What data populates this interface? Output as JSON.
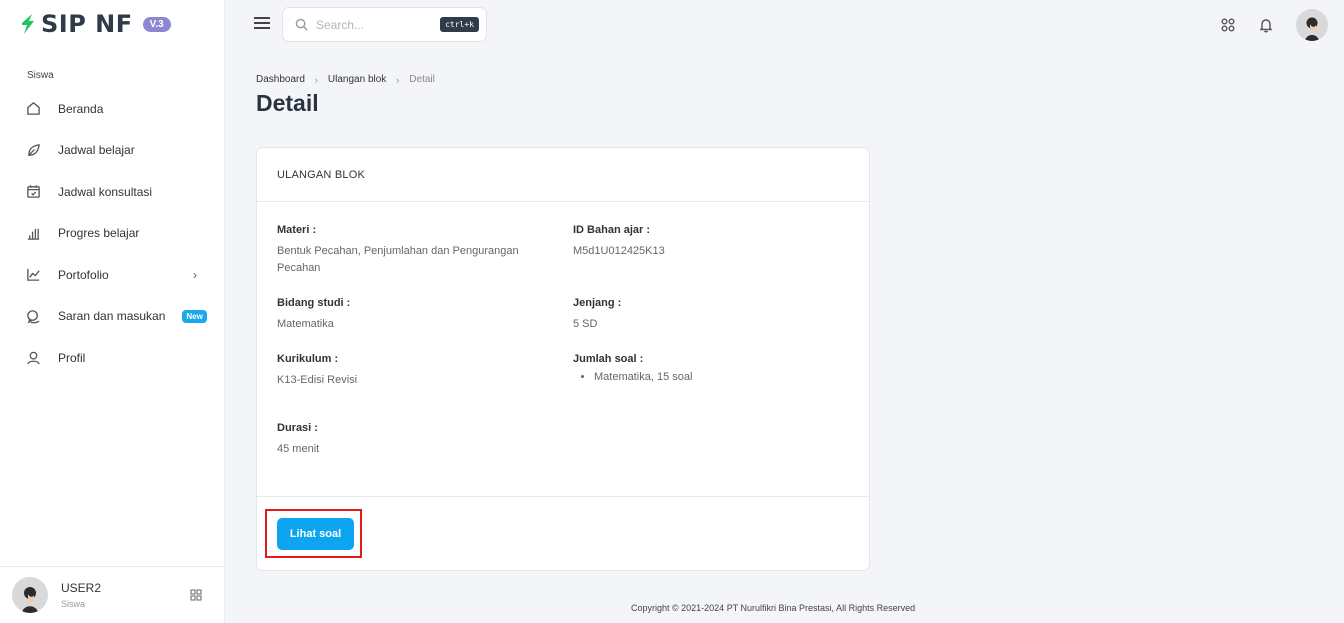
{
  "app": {
    "logo_text": "SIP NF",
    "version_badge": "V.3",
    "brand_green": "#22c55e",
    "accent": "#0ea5f0"
  },
  "sidebar": {
    "section_label": "Siswa",
    "items": [
      {
        "label": "Beranda",
        "icon": "home-icon"
      },
      {
        "label": "Jadwal belajar",
        "icon": "leaf-icon"
      },
      {
        "label": "Jadwal konsultasi",
        "icon": "calendar-check-icon"
      },
      {
        "label": "Progres belajar",
        "icon": "bar-chart-icon"
      },
      {
        "label": "Portofolio",
        "icon": "line-chart-icon",
        "has_submenu": true
      },
      {
        "label": "Saran dan masukan",
        "icon": "chat-icon",
        "badge": "New"
      },
      {
        "label": "Profil",
        "icon": "user-icon"
      }
    ],
    "user": {
      "name": "USER2",
      "role": "Siswa"
    }
  },
  "topbar": {
    "search_placeholder": "Search...",
    "search_shortcut": "ctrl+k"
  },
  "breadcrumb": [
    "Dashboard",
    "Ulangan blok",
    "Detail"
  ],
  "page_title": "Detail",
  "card": {
    "header": "ULANGAN BLOK",
    "fields": {
      "materi": {
        "label": "Materi :",
        "value": "Bentuk Pecahan, Penjumlahan dan Pengurangan Pecahan"
      },
      "id_bahan": {
        "label": "ID Bahan ajar :",
        "value": "M5d1U012425K13"
      },
      "bidang": {
        "label": "Bidang studi :",
        "value": "Matematika"
      },
      "jenjang": {
        "label": "Jenjang :",
        "value": "5 SD"
      },
      "kurikulum": {
        "label": "Kurikulum :",
        "value": "K13-Edisi Revisi"
      },
      "jumlah_soal": {
        "label": "Jumlah soal :",
        "items": [
          "Matematika, 15 soal"
        ]
      },
      "durasi": {
        "label": "Durasi :",
        "value": "45 menit"
      }
    },
    "button_label": "Lihat soal"
  },
  "footer": "Copyright © 2021-2024 PT Nurulfikri Bina Prestasi, All Rights Reserved"
}
